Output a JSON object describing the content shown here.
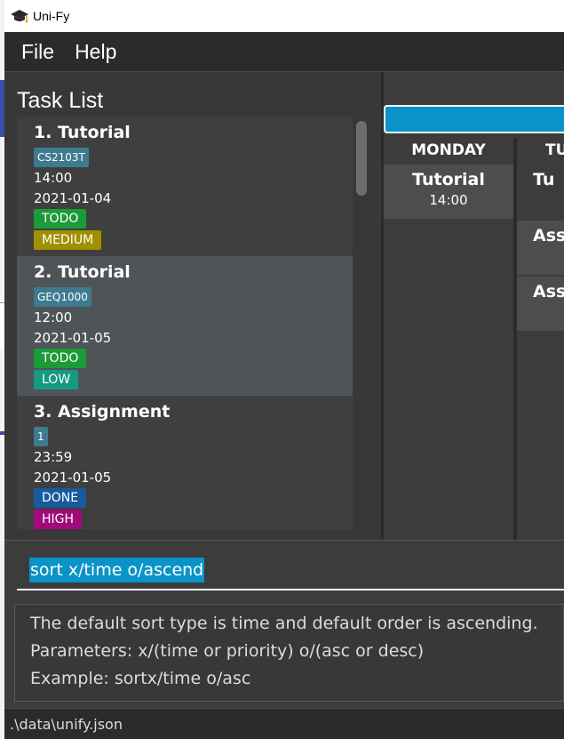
{
  "window": {
    "title": "Uni-Fy"
  },
  "menu": [
    {
      "label": "File"
    },
    {
      "label": "Help"
    }
  ],
  "task_list": {
    "title": "Task List",
    "tasks": [
      {
        "heading": "1.  Tutorial",
        "module": "CS2103T",
        "time": "14:00",
        "date": "2021-01-04",
        "state": "TODO",
        "priority": "MEDIUM"
      },
      {
        "heading": "2.  Tutorial",
        "module": "GEQ1000",
        "time": "12:00",
        "date": "2021-01-05",
        "state": "TODO",
        "priority": "LOW"
      },
      {
        "heading": "3.  Assignment",
        "module": "1",
        "time": "23:59",
        "date": "2021-01-05",
        "state": "DONE",
        "priority": "HIGH"
      }
    ]
  },
  "schedule": {
    "days": [
      {
        "label": "MONDAY",
        "events": [
          {
            "title": "Tutorial",
            "time": "14:00"
          }
        ]
      },
      {
        "label": "TU",
        "events": [
          {
            "title": "Tu",
            "time": ""
          },
          {
            "title": "Assi",
            "time": ""
          },
          {
            "title": "Assi",
            "time": ""
          }
        ]
      }
    ]
  },
  "command": {
    "value": "sort x/time o/ascend"
  },
  "result": {
    "lines": [
      "The default sort type is time and default order is ascending.",
      "Parameters: x/(time or priority) o/(asc or desc)",
      "Example: sortx/time o/asc"
    ]
  },
  "status": {
    "path": ".\\data\\unify.json"
  },
  "colors": {
    "accent": "#0a93c8",
    "todo": "#1c9b39",
    "done": "#175b9c",
    "medium": "#a08f00",
    "low": "#149983",
    "high": "#a10a7a",
    "module_tag": "#3e7b91"
  }
}
